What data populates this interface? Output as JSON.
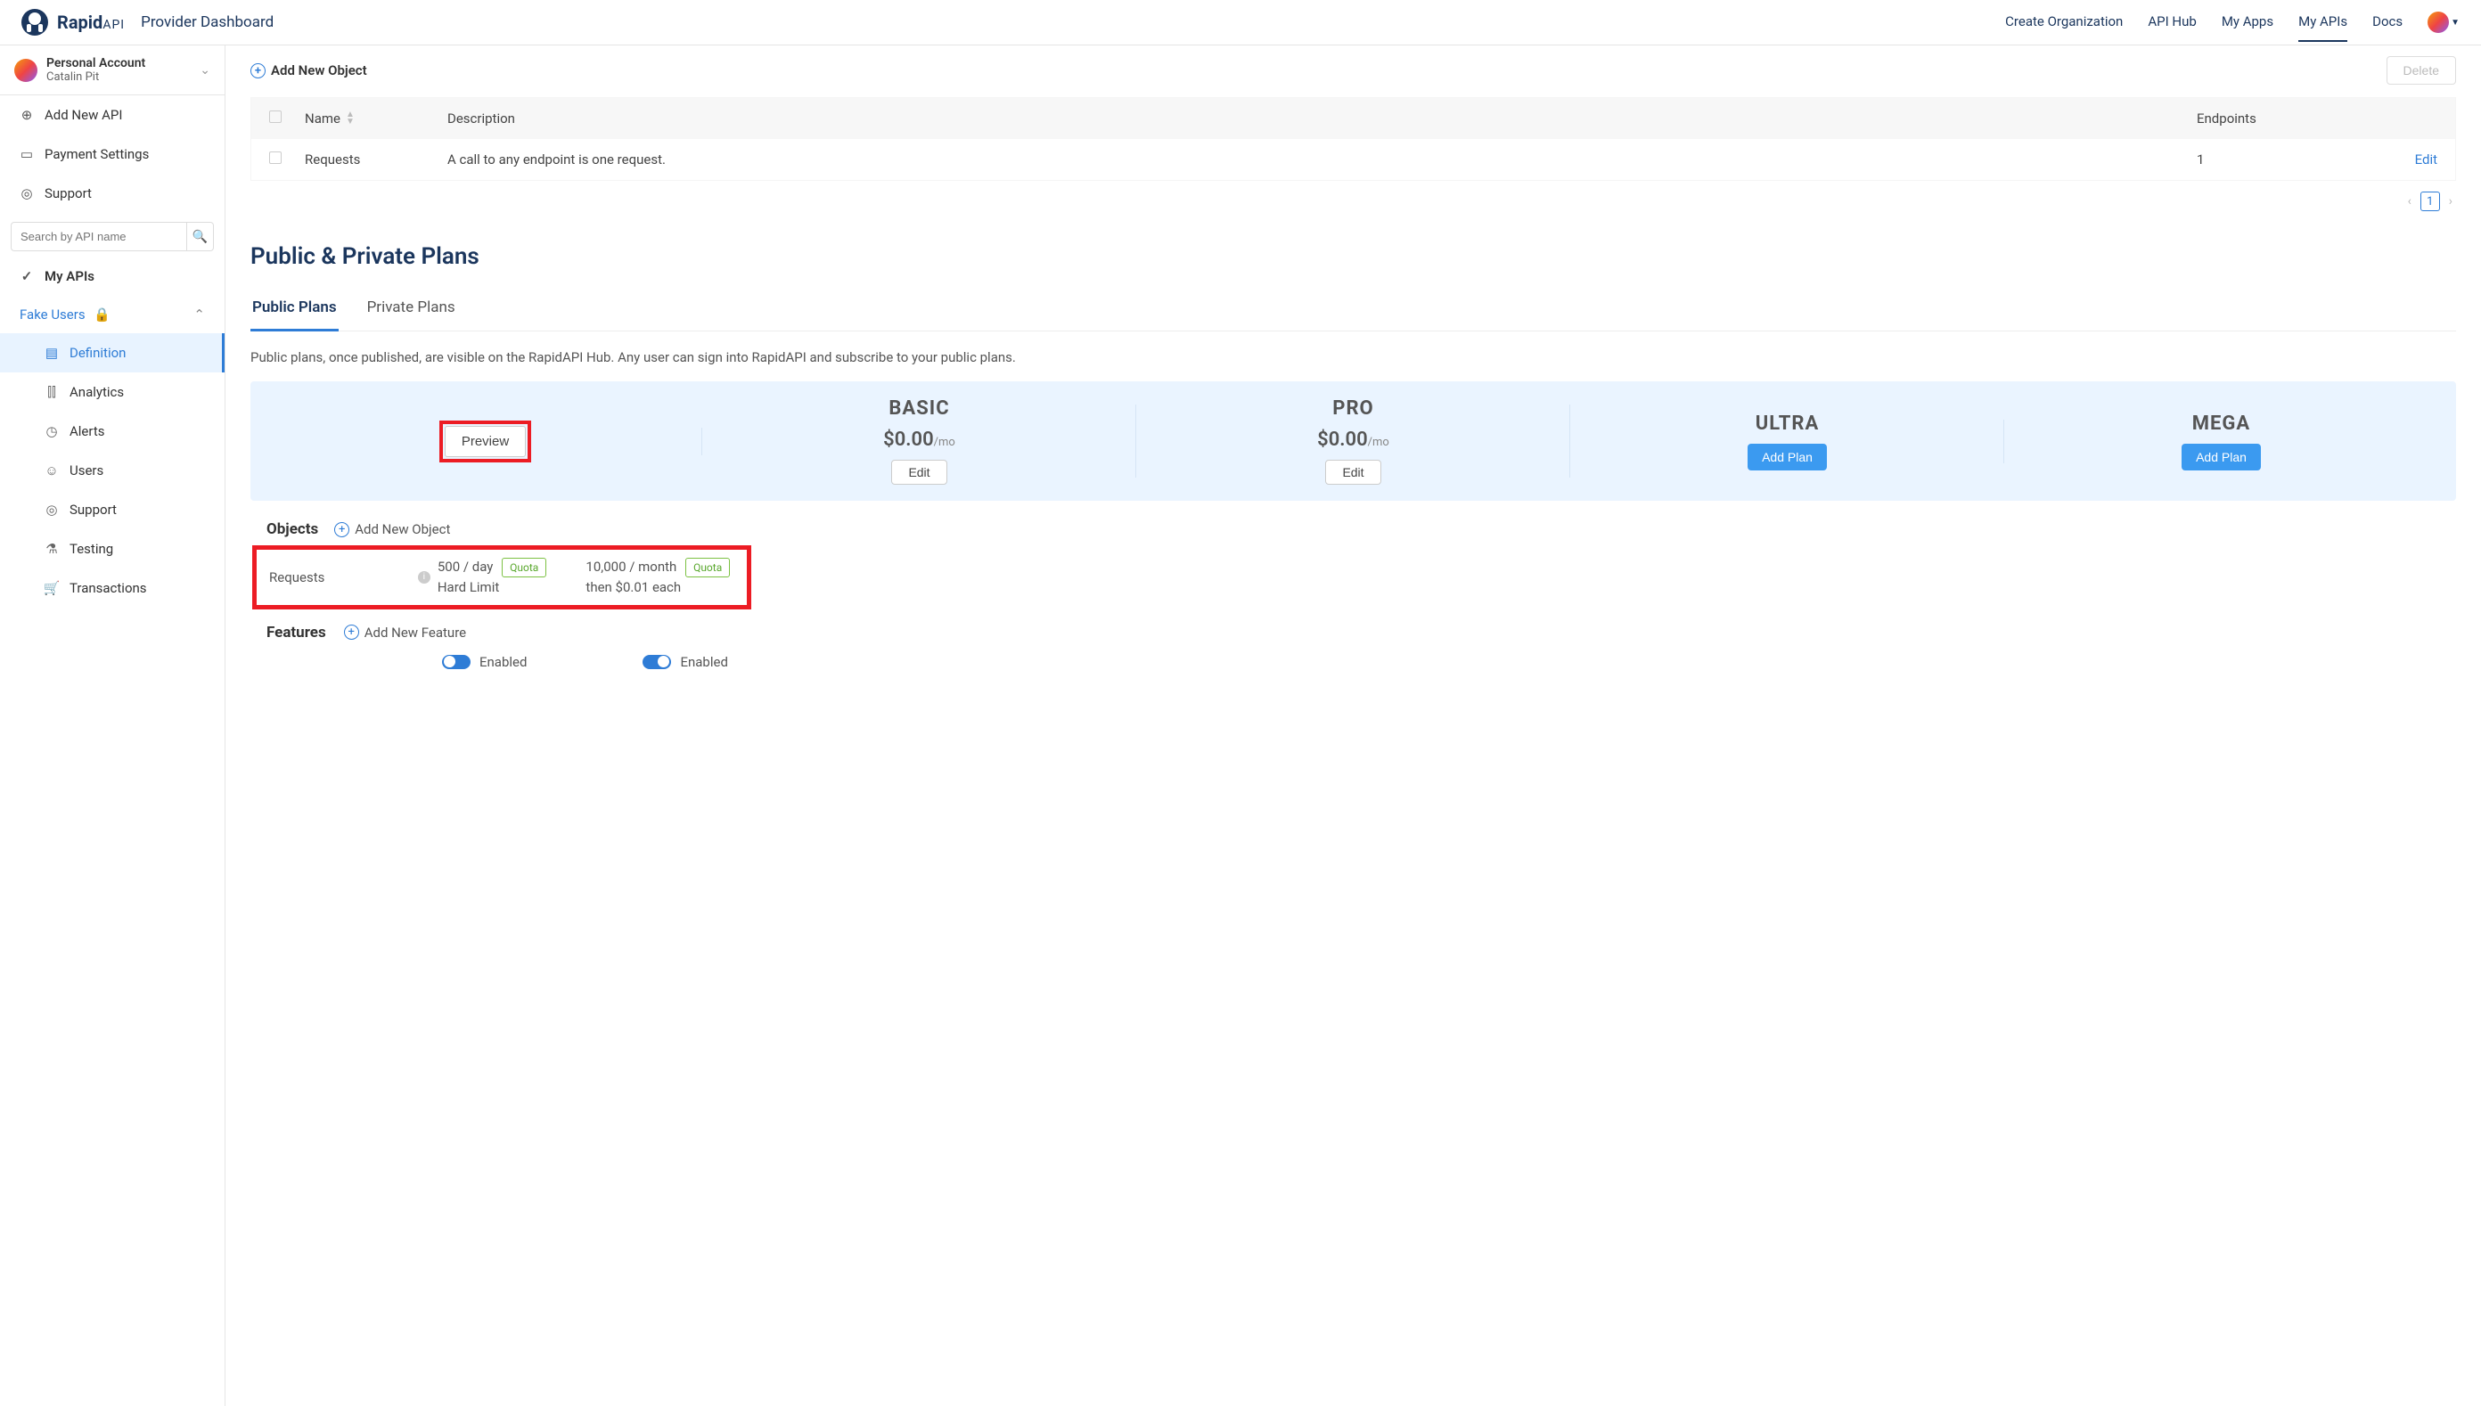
{
  "header": {
    "brand_main": "Rapid",
    "brand_sub": "API",
    "title": "Provider Dashboard",
    "links": [
      "Create Organization",
      "API Hub",
      "My Apps",
      "My APIs",
      "Docs"
    ],
    "active_index": 3
  },
  "sidebar": {
    "account_name": "Personal Account",
    "account_user": "Catalin Pit",
    "add_api": "Add New API",
    "payment": "Payment Settings",
    "support": "Support",
    "search_placeholder": "Search by API name",
    "my_apis": "My APIs",
    "api_name": "Fake Users",
    "sub": {
      "definition": "Definition",
      "analytics": "Analytics",
      "alerts": "Alerts",
      "users": "Users",
      "support2": "Support",
      "testing": "Testing",
      "transactions": "Transactions"
    }
  },
  "objects_top": {
    "add_label": "Add New Object",
    "delete_label": "Delete",
    "cols": {
      "name": "Name",
      "desc": "Description",
      "endpoints": "Endpoints"
    },
    "row": {
      "name": "Requests",
      "desc": "A call to any endpoint is one request.",
      "endpoints": "1",
      "edit": "Edit"
    },
    "page": "1"
  },
  "plans": {
    "title": "Public & Private Plans",
    "tabs": {
      "public": "Public Plans",
      "private": "Private Plans"
    },
    "desc": "Public plans, once published, are visible on the RapidAPI Hub. Any user can sign into RapidAPI and subscribe to your public plans.",
    "preview": "Preview",
    "basic": {
      "name": "BASIC",
      "price": "$0.00",
      "per": "/mo",
      "btn": "Edit"
    },
    "pro": {
      "name": "PRO",
      "price": "$0.00",
      "per": "/mo",
      "btn": "Edit"
    },
    "ultra": {
      "name": "ULTRA",
      "btn": "Add Plan"
    },
    "mega": {
      "name": "MEGA",
      "btn": "Add Plan"
    }
  },
  "objects": {
    "title": "Objects",
    "add": "Add New Object",
    "row": {
      "label": "Requests",
      "col1_line1": "500 / day",
      "col1_line2": "Hard Limit",
      "col1_badge": "Quota",
      "col2_line1": "10,000 / month",
      "col2_line2": "then $0.01 each",
      "col2_badge": "Quota"
    }
  },
  "features": {
    "title": "Features",
    "add": "Add New Feature",
    "toggle1": "Enabled",
    "toggle2": "Enabled"
  }
}
